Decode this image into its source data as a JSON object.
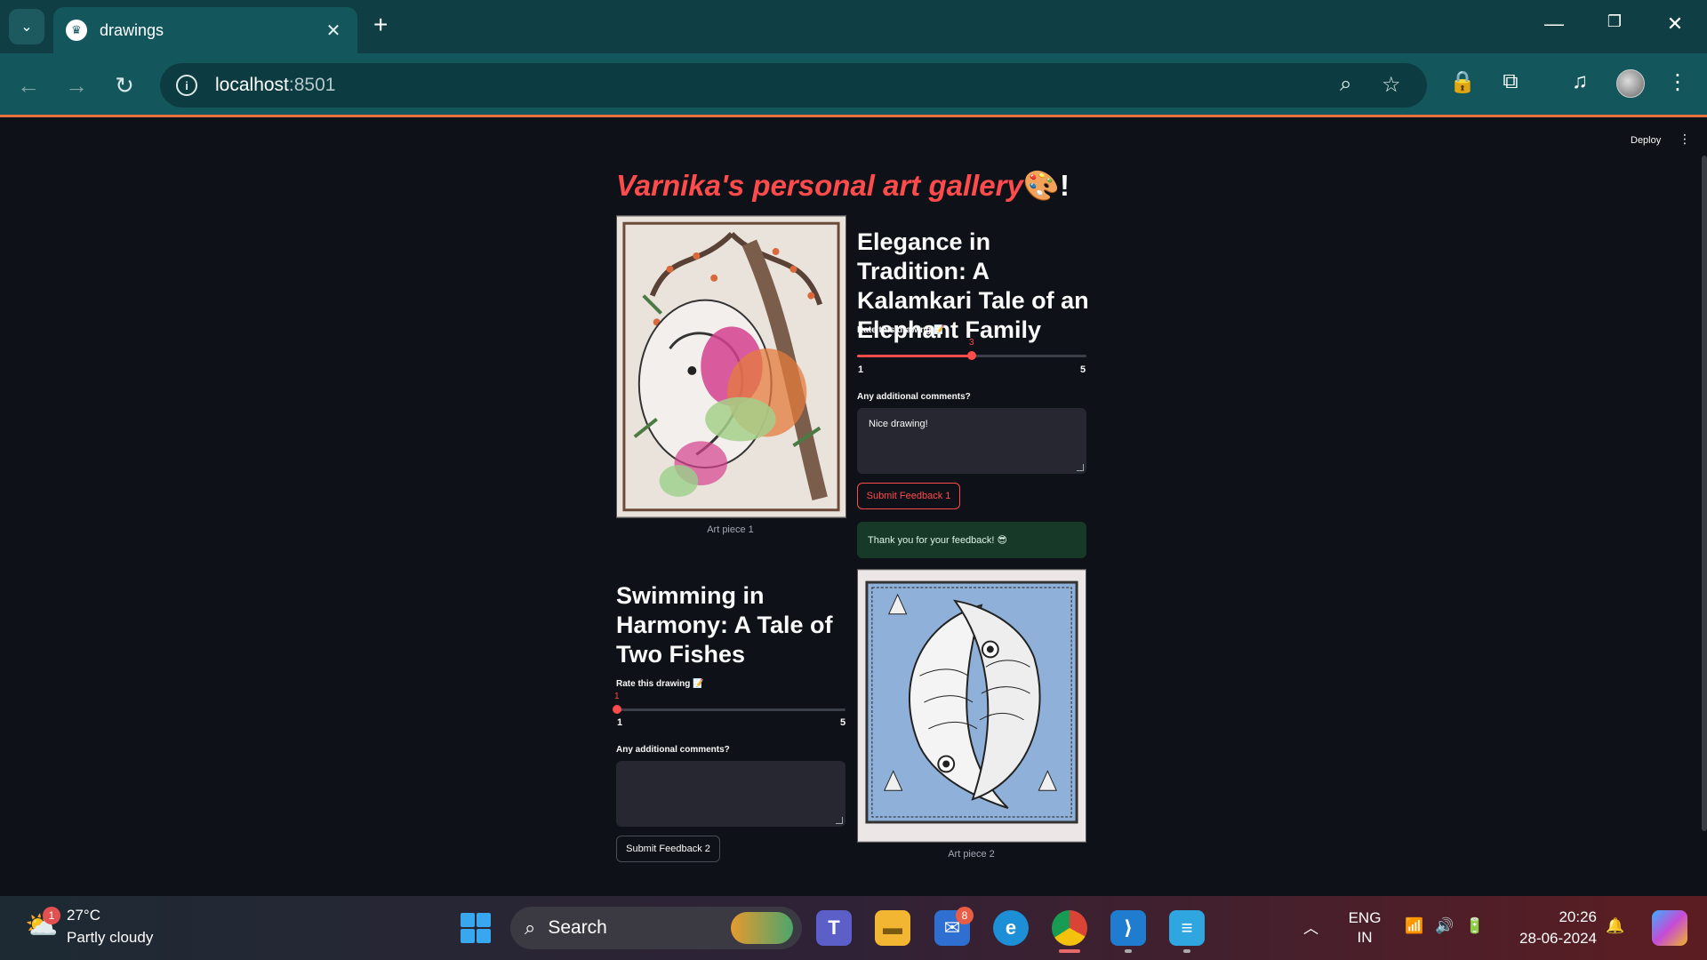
{
  "browser": {
    "tab_title": "drawings",
    "url_host": "localhost",
    "url_port": ":8501"
  },
  "app": {
    "deploy_label": "Deploy",
    "title_text": "Varnika's personal art gallery",
    "title_emoji": "🎨",
    "title_bang": "!",
    "accent_color": "#ff4b4b"
  },
  "art1": {
    "heading": "Elegance in Tradition: A Kalamkari Tale of an Elephant Family",
    "caption": "Art piece 1",
    "rate_label": "Rate this drawing",
    "slider_value": "3",
    "slider_min": "1",
    "slider_max": "5",
    "comments_label": "Any additional comments?",
    "comments_value": "Nice drawing!",
    "submit_label": "Submit Feedback 1",
    "success_text": "Thank you for your feedback! 😎"
  },
  "art2": {
    "heading": "Swimming in Harmony: A Tale of Two Fishes",
    "caption": "Art piece 2",
    "rate_label": "Rate this drawing",
    "slider_value": "1",
    "slider_min": "1",
    "slider_max": "5",
    "comments_label": "Any additional comments?",
    "comments_value": "",
    "submit_label": "Submit Feedback 2"
  },
  "taskbar": {
    "weather_badge": "1",
    "temperature": "27°C",
    "condition": "Partly cloudy",
    "search_placeholder": "Search",
    "mail_badge": "8",
    "lang_top": "ENG",
    "lang_bottom": "IN",
    "time": "20:26",
    "date": "28-06-2024"
  }
}
